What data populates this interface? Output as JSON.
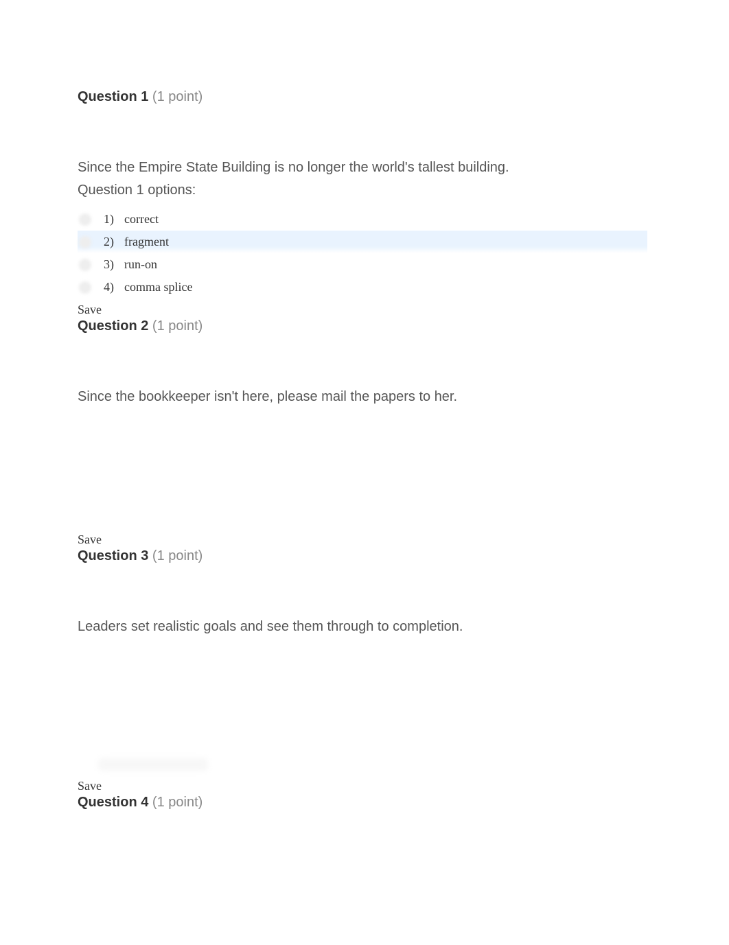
{
  "questions": [
    {
      "label": "Question 1",
      "points": "(1 point)",
      "text": "Since the Empire State Building is no longer the world's tallest building.",
      "options_label": "Question 1 options:",
      "options": [
        {
          "num": "1)",
          "text": "correct"
        },
        {
          "num": "2)",
          "text": "fragment"
        },
        {
          "num": "3)",
          "text": "run-on"
        },
        {
          "num": "4)",
          "text": "comma splice"
        }
      ],
      "save": "Save"
    },
    {
      "label": "Question 2",
      "points": "(1 point)",
      "text": "Since the bookkeeper isn't here, please mail the papers to her.",
      "save": "Save"
    },
    {
      "label": "Question 3",
      "points": "(1 point)",
      "text": "Leaders set realistic goals and see them through to completion.",
      "save": "Save"
    },
    {
      "label": "Question 4",
      "points": "(1 point)"
    }
  ]
}
